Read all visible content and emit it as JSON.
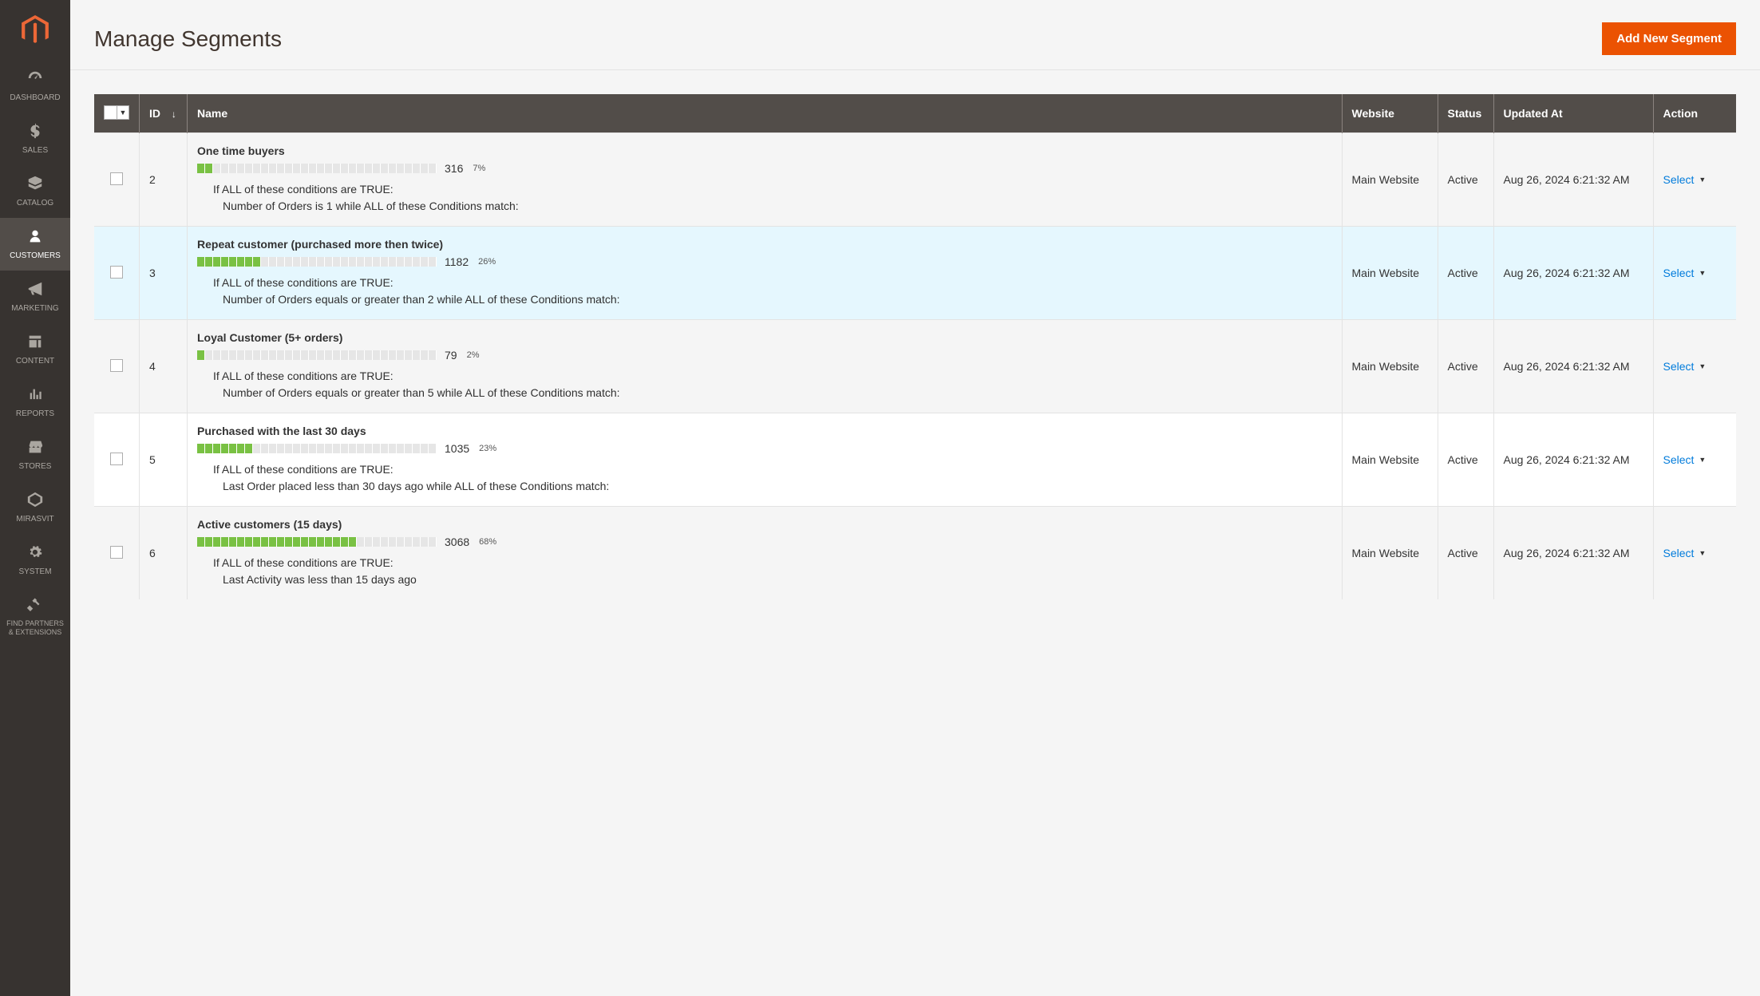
{
  "sidebar": {
    "items": [
      {
        "label": "DASHBOARD",
        "icon": "dashboard"
      },
      {
        "label": "SALES",
        "icon": "sales"
      },
      {
        "label": "CATALOG",
        "icon": "catalog"
      },
      {
        "label": "CUSTOMERS",
        "icon": "customers",
        "active": true
      },
      {
        "label": "MARKETING",
        "icon": "marketing"
      },
      {
        "label": "CONTENT",
        "icon": "content"
      },
      {
        "label": "REPORTS",
        "icon": "reports"
      },
      {
        "label": "STORES",
        "icon": "stores"
      },
      {
        "label": "MIRASVIT",
        "icon": "mirasvit"
      },
      {
        "label": "SYSTEM",
        "icon": "system"
      },
      {
        "label": "FIND PARTNERS & EXTENSIONS",
        "icon": "partners"
      }
    ]
  },
  "header": {
    "title": "Manage Segments",
    "add_button": "Add New Segment"
  },
  "table": {
    "columns": {
      "id": "ID",
      "name": "Name",
      "website": "Website",
      "status": "Status",
      "updated_at": "Updated At",
      "action": "Action"
    },
    "sort_indicator": "↓",
    "action_label": "Select",
    "bar_segments_total": 30,
    "rows": [
      {
        "id": "2",
        "name": "One time buyers",
        "count": "316",
        "pct": "7%",
        "bar_fill": 2,
        "cond_head": "If ALL of these conditions are TRUE:",
        "cond_body": "Number of Orders  is 1 while ALL of these Conditions match:",
        "website": "Main Website",
        "status": "Active",
        "updated_at": "Aug 26, 2024 6:21:32 AM",
        "row_class": "even"
      },
      {
        "id": "3",
        "name": "Repeat customer (purchased more then twice)",
        "count": "1182",
        "pct": "26%",
        "bar_fill": 8,
        "cond_head": "If ALL of these conditions are TRUE:",
        "cond_body": "Number of Orders  equals or greater than 2 while ALL of these Conditions match:",
        "website": "Main Website",
        "status": "Active",
        "updated_at": "Aug 26, 2024 6:21:32 AM",
        "row_class": "hovered"
      },
      {
        "id": "4",
        "name": "Loyal Customer (5+ orders)",
        "count": "79",
        "pct": "2%",
        "bar_fill": 1,
        "cond_head": "If ALL of these conditions are TRUE:",
        "cond_body": "Number of Orders  equals or greater than 5 while ALL of these Conditions match:",
        "website": "Main Website",
        "status": "Active",
        "updated_at": "Aug 26, 2024 6:21:32 AM",
        "row_class": "even"
      },
      {
        "id": "5",
        "name": "Purchased with the last 30 days",
        "count": "1035",
        "pct": "23%",
        "bar_fill": 7,
        "cond_head": "If ALL of these conditions are TRUE:",
        "cond_body": "Last Order placed less than 30 days ago while ALL of these Conditions match:",
        "website": "Main Website",
        "status": "Active",
        "updated_at": "Aug 26, 2024 6:21:32 AM",
        "row_class": "odd"
      },
      {
        "id": "6",
        "name": "Active customers (15 days)",
        "count": "3068",
        "pct": "68%",
        "bar_fill": 20,
        "cond_head": "If ALL of these conditions are TRUE:",
        "cond_body": "Last Activity was less than 15 days ago",
        "website": "Main Website",
        "status": "Active",
        "updated_at": "Aug 26, 2024 6:21:32 AM",
        "row_class": "even"
      }
    ]
  }
}
